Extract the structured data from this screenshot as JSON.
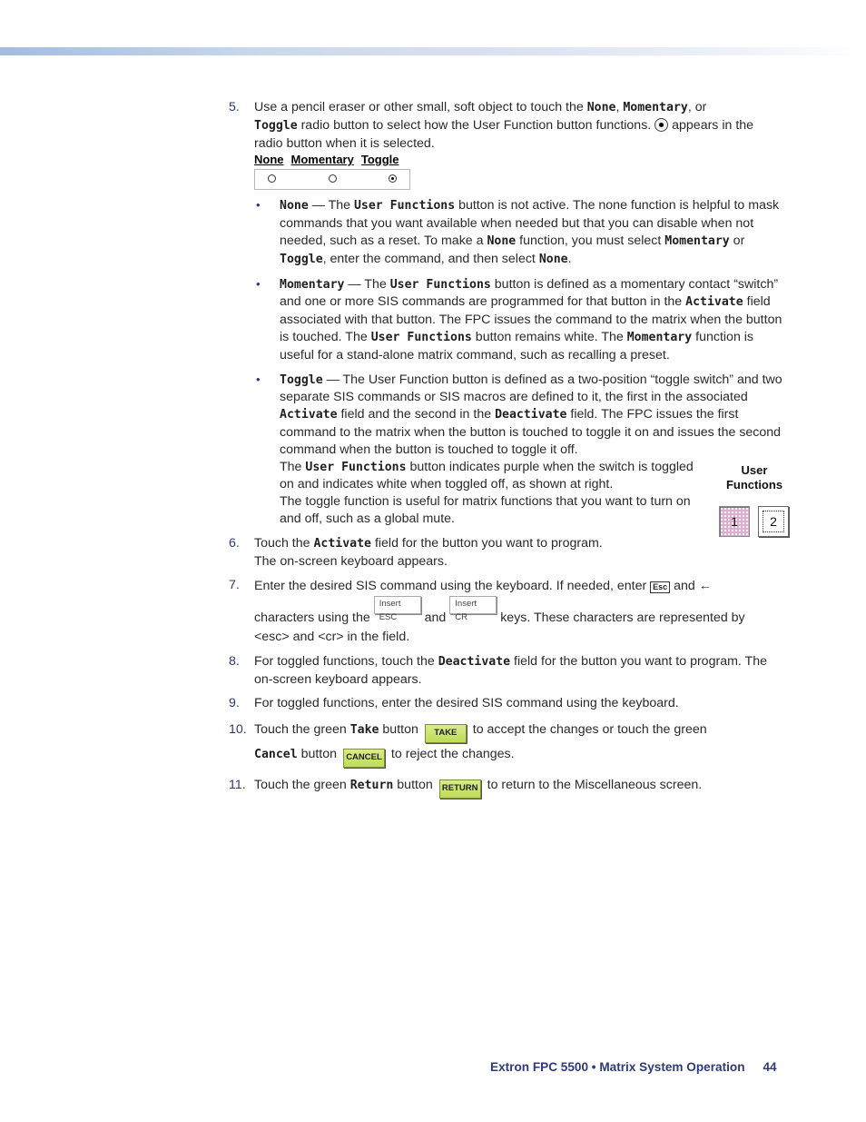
{
  "header": {
    "bar": "decorative-gradient-bar"
  },
  "steps": {
    "s5": {
      "num": "5.",
      "t1": "Use a pencil eraser or other small, soft object to touch the ",
      "none": "None",
      "t2": ", ",
      "momentary": "Momentary",
      "t3": ", or",
      "toggle": "Toggle",
      "t4": " radio button to select how the User Function button functions. ",
      "t5": " appears in the radio button when it is selected.",
      "radio_labels": [
        "None",
        "Momentary",
        "Toggle"
      ],
      "radio_selected": "Toggle"
    },
    "bullets": {
      "none": {
        "term": "None",
        "t1": " — The ",
        "uf": "User Functions",
        "t2": " button is not active. The none function is helpful to mask commands that you want available when needed but that you can disable when not needed, such as a reset. To make a ",
        "none": "None",
        "t3": " function, you must select ",
        "momentary": "Momentary",
        "t4": " or ",
        "toggle": "Toggle",
        "t5": ", enter the command, and then select ",
        "none2": "None",
        "t6": "."
      },
      "momentary": {
        "term": "Momentary",
        "t1": " — The ",
        "uf": "User Functions",
        "t2": " button is defined as a momentary contact “switch” and one or more SIS commands are programmed for that button in the ",
        "activate": "Activate",
        "t3": " field associated with that button. The FPC issues the command to the matrix when the button is touched. The ",
        "uf2": "User Functions",
        "t4": " button remains white. The ",
        "momentary2": "Momentary",
        "t5": " function is useful for a stand-alone matrix command, such as recalling a preset."
      },
      "toggle": {
        "term": "Toggle",
        "t1": " — The User Function button is defined as a two-position “toggle switch” and two separate SIS commands or SIS macros are defined to it, the first in the associated ",
        "activate": "Activate",
        "t2": " field and the second in the ",
        "deactivate": "Deactivate",
        "t3": " field. The FPC issues the first command to the matrix when the button is touched to toggle it on and issues the second command when the button is touched to toggle it off.",
        "t4": "The ",
        "uf": "User Functions",
        "t5": " button indicates purple when the switch is toggled on and indicates white when toggled off, as shown at right.",
        "t6": "The toggle function is useful for matrix functions that you want to turn on and off, such as a global mute."
      }
    },
    "user_functions_figure": {
      "title_line1": "User",
      "title_line2": "Functions",
      "btn1": "1",
      "btn2": "2",
      "btn1_state": "toggled on (purple)",
      "btn2_state": "toggled off (white)"
    },
    "s6": {
      "num": "6.",
      "t1": "Touch the ",
      "activate": "Activate",
      "t2": " field for the button you want to program.",
      "t3": "The on-screen keyboard appears."
    },
    "s7": {
      "num": "7.",
      "t1": "Enter the desired SIS command using the keyboard. If needed, enter ",
      "esc_key": "Esc",
      "t2": " and ",
      "arrow": "←",
      "t3": " characters using the ",
      "insert_esc": "Insert ESC",
      "t4": " and ",
      "insert_cr": "Insert CR",
      "t5": " keys. These characters are represented by <esc> and <cr> in the field."
    },
    "s8": {
      "num": "8.",
      "t1": "For toggled functions, touch the ",
      "deactivate": "Deactivate",
      "t2": " field for the button you want to program. The on-screen keyboard appears."
    },
    "s9": {
      "num": "9.",
      "t1": "For toggled functions, enter the desired SIS command using the keyboard."
    },
    "s10": {
      "num": "10.",
      "t1": "Touch the green ",
      "take": "Take",
      "t2": " button ",
      "take_btn": "TAKE",
      "t3": " to accept the changes or touch the green ",
      "cancel": "Cancel",
      "t4": " button ",
      "cancel_btn": "CANCEL",
      "t5": " to reject the changes."
    },
    "s11": {
      "num": "11.",
      "t1": "Touch the green ",
      "return": "Return",
      "t2": " button ",
      "return_btn": "RETURN",
      "t3": " to return to the Miscellaneous screen."
    }
  },
  "footer": {
    "title": "Extron FPC 5500 • Matrix System Operation",
    "page": "44"
  }
}
